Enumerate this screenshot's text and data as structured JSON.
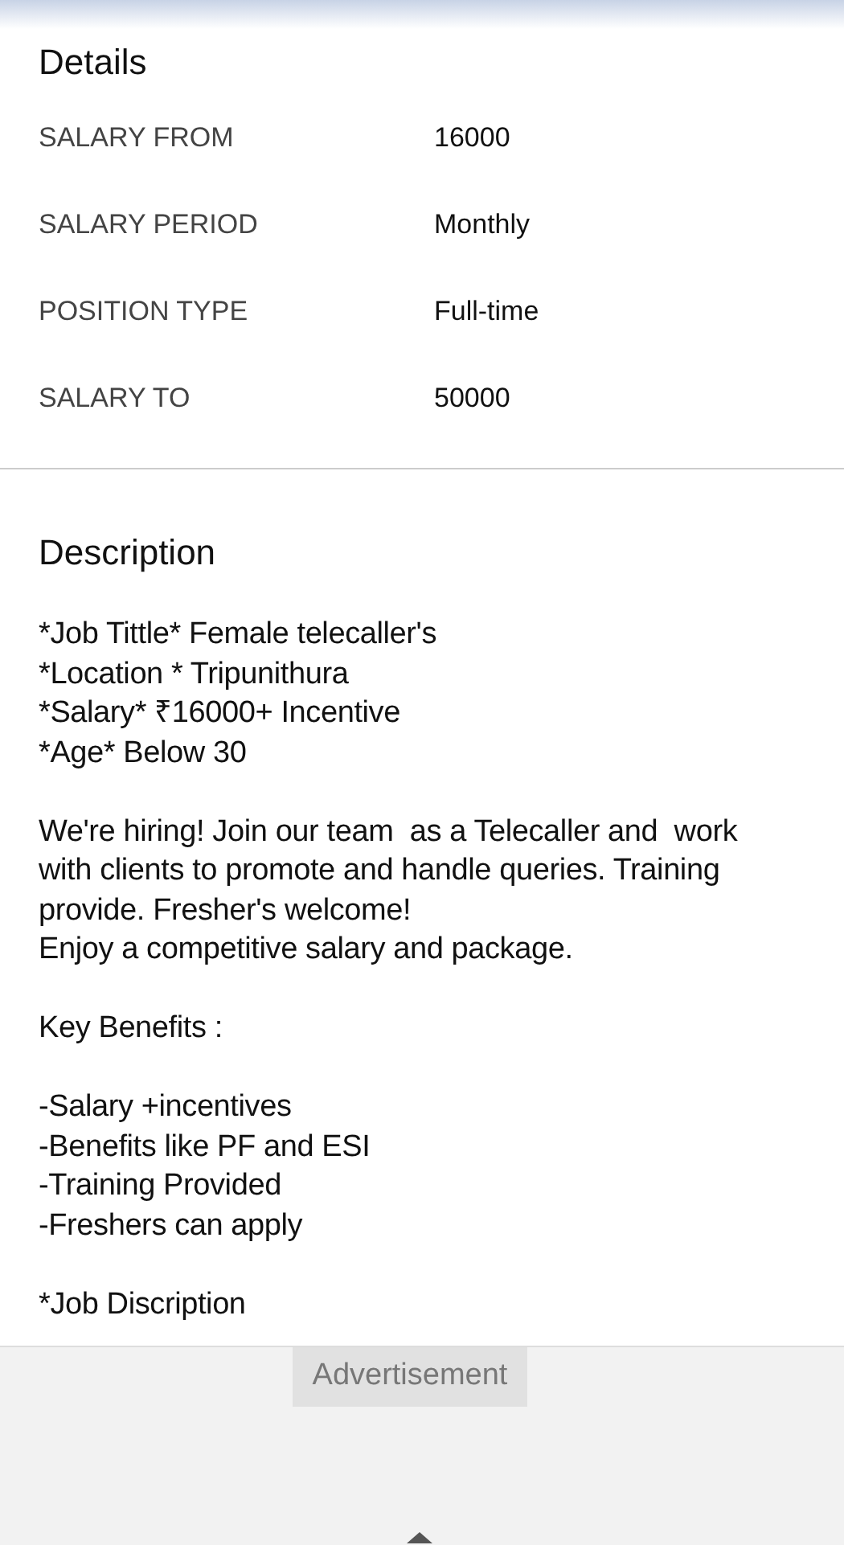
{
  "details": {
    "title": "Details",
    "rows": [
      {
        "label": "SALARY FROM",
        "value": "16000"
      },
      {
        "label": "SALARY PERIOD",
        "value": "Monthly"
      },
      {
        "label": "POSITION TYPE",
        "value": "Full-time"
      },
      {
        "label": "SALARY TO",
        "value": "50000"
      }
    ]
  },
  "description": {
    "title": "Description",
    "paragraphs": [
      [
        "*Job Tittle* Female telecaller's",
        "*Location * Tripunithura",
        "*Salary* ₹16000+ Incentive",
        "*Age* Below 30"
      ],
      [
        "We're hiring! Join our team  as a Telecaller and  work",
        "with clients to promote and handle queries. Training",
        "provide. Fresher's welcome!",
        "Enjoy a competitive salary and package."
      ],
      [
        "Key Benefits :"
      ],
      [
        "-Salary +incentives",
        "-Benefits like PF and ESI",
        "-Training Provided",
        "-Freshers can apply"
      ],
      [
        "*Job Discription"
      ]
    ]
  },
  "advertisement": {
    "label": "Advertisement"
  }
}
